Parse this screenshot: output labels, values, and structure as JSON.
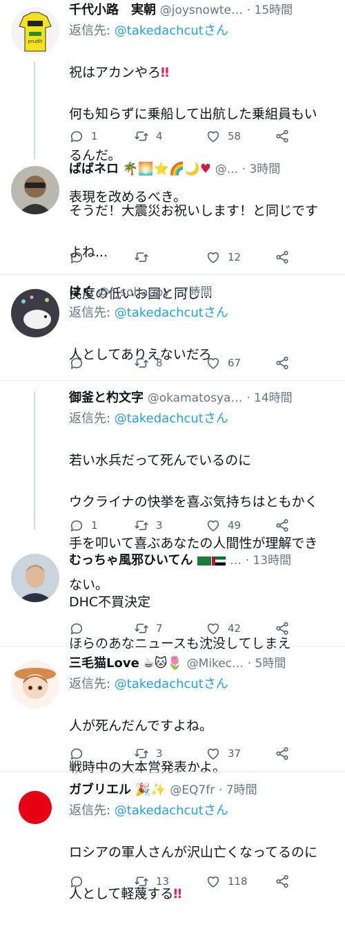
{
  "tweets": [
    {
      "display_name": "千代小路　実朝",
      "handle": "@joysnowte…",
      "time": "· 15時間",
      "reply_prefix": "返信先: ",
      "reply_handle": "@takedachcutさん",
      "lines": [
        "祝はアカンやろ",
        "何も知らずに乗船して出航した乗組員もい",
        "るんだ。",
        "表現を改めるべき。"
      ],
      "counts": {
        "reply": "1",
        "retweet": "4",
        "like": "58"
      },
      "avatar": "yellow-jersey"
    },
    {
      "display_name": "ばばネロ",
      "handle": "@...",
      "time": "· 3時間",
      "lines": [
        "そうだ！大震災お祝いします！と同じです",
        "よね...",
        "民度の低いお国と同じ..."
      ],
      "counts": {
        "reply": "",
        "retweet": "",
        "like": "12"
      },
      "avatar": "person-sunglasses"
    },
    {
      "display_name": "はく",
      "handle": "@r_sohappy",
      "time": "· 7時間",
      "reply_prefix": "返信先: ",
      "reply_handle": "@takedachcutさん",
      "lines": [
        "人としてありえないだろ"
      ],
      "counts": {
        "reply": "",
        "retweet": "8",
        "like": "67"
      },
      "avatar": "white-bird"
    },
    {
      "display_name": "御釜と杓文字",
      "handle": "@okamatosya…",
      "time": "· 14時間",
      "reply_prefix": "返信先: ",
      "reply_handle": "@takedachcutさん",
      "lines": [
        "若い水兵だって死んでいるのに",
        "ウクライナの快挙を喜ぶ気持ちはともかく",
        "手を叩いて喜ぶあなたの人間性が理解でき",
        "ない。"
      ],
      "counts": {
        "reply": "1",
        "retweet": "3",
        "like": "49"
      },
      "avatar": "blank"
    },
    {
      "display_name": "むっちゃ風邪ひいてん",
      "handle": "…",
      "time": "· 13時間",
      "lines": [
        "DHC不買決定",
        "ほらのあなニュースも沈没してしまえ"
      ],
      "counts": {
        "reply": "",
        "retweet": "7",
        "like": "42"
      },
      "avatar": "man-portrait"
    },
    {
      "display_name": "三毛猫Love",
      "handle": "@Mikec…",
      "time": "· 5時間",
      "reply_prefix": "返信先: ",
      "reply_handle": "@takedachcutさん",
      "lines": [
        "人が死んだんですよね。",
        "戦時中の大本営発表かよ。"
      ],
      "counts": {
        "reply": "",
        "retweet": "3",
        "like": "37"
      },
      "avatar": "anime-girl"
    },
    {
      "display_name": "ガブリエル",
      "handle": "@EQ7fr",
      "time": "· 7時間",
      "reply_prefix": "返信先: ",
      "reply_handle": "@takedachcutさん",
      "lines": [
        "ロシアの軍人さんが沢山亡くなってるのに",
        "人として軽蔑する"
      ],
      "counts": {
        "reply": "",
        "retweet": "13",
        "like": "118"
      },
      "avatar": "red-circle"
    }
  ],
  "colors": {
    "accent": "#1da1f2",
    "meta": "#657786",
    "divider": "#e6ecf0",
    "bangs": "#e0245e"
  }
}
